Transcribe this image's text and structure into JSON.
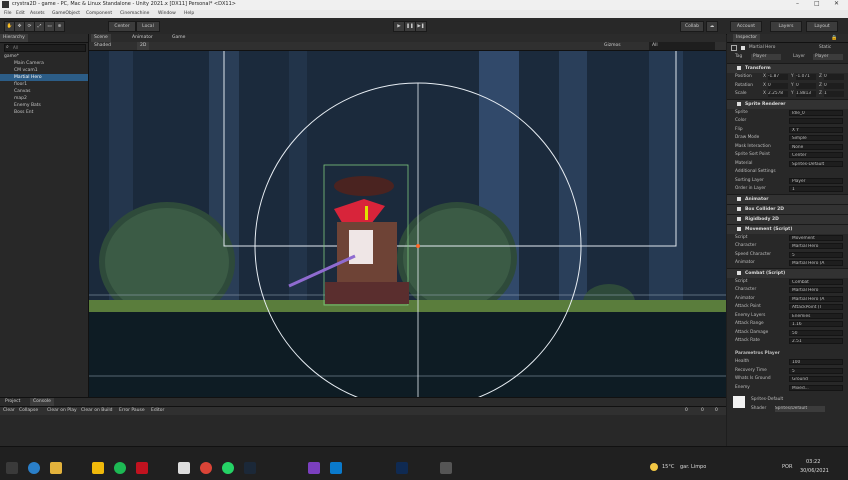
{
  "window": {
    "title": "crystra2D - game - PC, Mac & Linux Standalone - Unity 2021.x [DX11] Personal* <DX11>",
    "controls": [
      "–",
      "□",
      "✕"
    ]
  },
  "menu": [
    "File",
    "Edit",
    "Assets",
    "GameObject",
    "Component",
    "Cinemachine",
    "Window",
    "Help"
  ],
  "toolbar": {
    "center": "Center",
    "local": "Local",
    "collab": "Collab",
    "account": "Account",
    "layers": "Layers",
    "layout": "Layout"
  },
  "hierarchy": {
    "tab": "Hierarchy",
    "search_placeholder": "All",
    "items": [
      {
        "label": "game*",
        "indent": 0
      },
      {
        "label": "Main Camera",
        "indent": 2
      },
      {
        "label": "CM vcam1",
        "indent": 2
      },
      {
        "label": "Martial Hero",
        "indent": 2,
        "selected": true
      },
      {
        "label": "floor1",
        "indent": 2
      },
      {
        "label": "Canvas",
        "indent": 2
      },
      {
        "label": "map2",
        "indent": 2
      },
      {
        "label": "Enemy Bats",
        "indent": 2
      },
      {
        "label": "Boss Ent",
        "indent": 2
      }
    ]
  },
  "scene": {
    "tabs": [
      "Scene",
      "Animator",
      "Game"
    ],
    "shading": "Shaded",
    "mode": "2D",
    "gizmos": "Gizmos",
    "search": "All"
  },
  "inspector": {
    "tab": "Inspector",
    "object_name": "Martial Hero",
    "static_label": "Static",
    "tag_label": "Tag",
    "tag": "Player",
    "layer_label": "Layer",
    "layer": "Player",
    "transform": {
      "title": "Transform",
      "rows": [
        {
          "label": "Position",
          "x": "-1.87",
          "y": "-1.071",
          "z": "0"
        },
        {
          "label": "Rotation",
          "x": "0",
          "y": "0",
          "z": "0"
        },
        {
          "label": "Scale",
          "x": "2.2578",
          "y": "1.8813",
          "z": "1"
        }
      ]
    },
    "sprite_renderer": {
      "title": "Sprite Renderer",
      "rows": [
        {
          "label": "Sprite",
          "value": "Idle_0"
        },
        {
          "label": "Color",
          "value": ""
        },
        {
          "label": "Flip",
          "value": "X  Y"
        },
        {
          "label": "Draw Mode",
          "value": "Simple"
        },
        {
          "label": "Mask Interaction",
          "value": "None"
        },
        {
          "label": "Sprite Sort Point",
          "value": "Center"
        },
        {
          "label": "Material",
          "value": "Sprites-Default"
        }
      ],
      "additional_title": "Additional Settings",
      "sorting_layer_label": "Sorting Layer",
      "sorting_layer": "Player",
      "order_label": "Order in Layer",
      "order": "1"
    },
    "components": [
      "Animator",
      "Box Collider 2D",
      "Rigidbody 2D",
      "Movement (Script)"
    ],
    "movement": {
      "rows": [
        {
          "label": "Script",
          "value": "Movement"
        },
        {
          "label": "Character",
          "value": "Martial Hero"
        },
        {
          "label": "Speed Character",
          "value": "5"
        },
        {
          "label": "Animator",
          "value": "Martial Hero (A"
        }
      ]
    },
    "combat": {
      "title": "Combat (Script)",
      "rows": [
        {
          "label": "Script",
          "value": "Combat"
        },
        {
          "label": "Character",
          "value": "Martial Hero"
        },
        {
          "label": "Animator",
          "value": "Martial Hero (A"
        },
        {
          "label": "Attack Point",
          "value": "AttackPoint (T"
        },
        {
          "label": "Enemy Layers",
          "value": "Enemies"
        },
        {
          "label": "Attack Range",
          "value": "1.16"
        },
        {
          "label": "Attack Damage",
          "value": "50"
        },
        {
          "label": "Attack Rate",
          "value": "2.51"
        }
      ]
    },
    "params": {
      "title": "Parametros Player",
      "rows": [
        {
          "label": "Health",
          "value": "100"
        },
        {
          "label": "Recovery Time",
          "value": "5"
        },
        {
          "label": "Whats Is Ground",
          "value": "Ground"
        },
        {
          "label": "Enemy",
          "value": "Mixed..."
        }
      ]
    },
    "material": {
      "name": "Sprites-Default",
      "shader_label": "Shader",
      "shader": "Sprites/Default"
    }
  },
  "bottom": {
    "tabs": [
      "Project",
      "Console"
    ],
    "console_buttons": [
      "Clear",
      "Collapse",
      "Clear on Play",
      "Clear on Build",
      "Error Pause",
      "Editor"
    ],
    "counts": [
      "0",
      "0",
      "0"
    ]
  },
  "taskbar": {
    "weather": "15°C",
    "weather_desc": "gar. Limpo",
    "lang": "POR",
    "time": "03:22",
    "date": "30/06/2021"
  }
}
